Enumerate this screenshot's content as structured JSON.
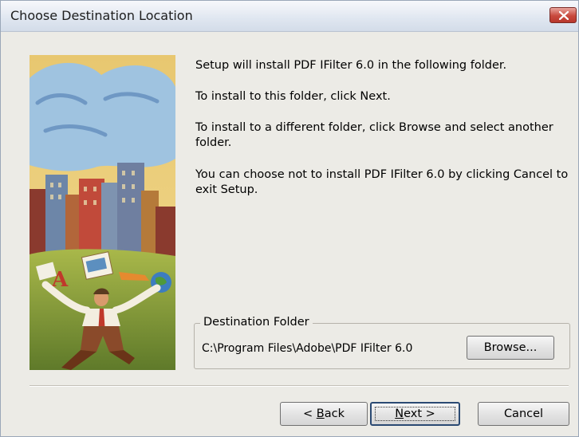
{
  "window": {
    "title": "Choose Destination Location"
  },
  "messages": {
    "line1": "Setup will install PDF IFilter 6.0 in the following folder.",
    "line2": "To install to this folder, click Next.",
    "line3": "To install to a different folder, click Browse and select another folder.",
    "line4": "You can choose not to install PDF IFilter 6.0 by clicking Cancel to exit Setup."
  },
  "destination": {
    "group_label": "Destination Folder",
    "path": "C:\\Program Files\\Adobe\\PDF IFilter 6.0",
    "browse_label": "Browse..."
  },
  "buttons": {
    "back_prefix": "< ",
    "back_key": "B",
    "back_rest": "ack",
    "next_key": "N",
    "next_rest": "ext >",
    "cancel": "Cancel"
  },
  "colors": {
    "title_close": "#c8493d",
    "accent_border": "#2b4a73"
  },
  "icons": {
    "close": "close-icon"
  }
}
